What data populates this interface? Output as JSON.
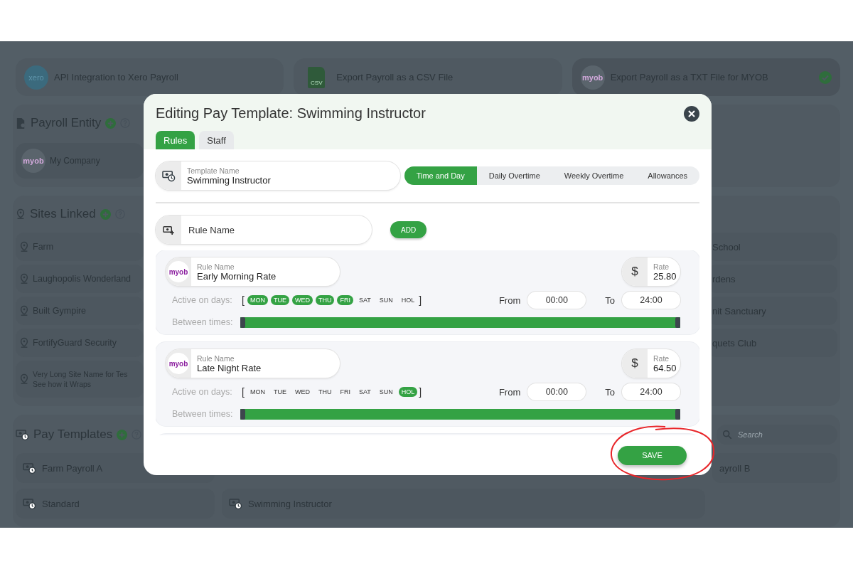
{
  "background": {
    "payroll_formats": [
      {
        "kind": "xero",
        "logo": "xero",
        "label": "API Integration to Xero Payroll",
        "selected": false
      },
      {
        "kind": "csv",
        "logo": "CSV",
        "label": "Export Payroll as a CSV File",
        "selected": false
      },
      {
        "kind": "myob",
        "logo": "myob",
        "label": "Export Payroll as a TXT File for MYOB",
        "selected": true
      }
    ],
    "payroll_entity": {
      "title": "Payroll Entity",
      "items": [
        {
          "logo": "myob",
          "label": "My Company"
        }
      ]
    },
    "sites_linked": {
      "title": "Sites Linked",
      "left": [
        "Farm",
        "Laughopolis Wonderland",
        "Built Gympire",
        "FortifyGuard Security",
        "Very Long Site Name for Tes\nSee how it Wraps"
      ],
      "right": [
        "School",
        "rdens",
        "nit Sanctuary",
        "quets Club"
      ]
    },
    "pay_templates": {
      "title": "Pay Templates",
      "search": {
        "placeholder": "Search"
      },
      "left": [
        "Farm Payroll A",
        "Standard"
      ],
      "middle": [
        "Swimming Instructor"
      ],
      "right": [
        "ayroll B"
      ]
    }
  },
  "modal": {
    "title": "Editing Pay Template: Swimming Instructor",
    "tabs": [
      {
        "label": "Rules",
        "selected": true
      },
      {
        "label": "Staff",
        "selected": false
      }
    ],
    "template_name": {
      "label": "Template Name",
      "value": "Swimming Instructor"
    },
    "rule_tabs": [
      {
        "label": "Time and Day",
        "selected": true
      },
      {
        "label": "Daily Overtime",
        "selected": false
      },
      {
        "label": "Weekly Overtime",
        "selected": false
      },
      {
        "label": "Allowances",
        "selected": false
      }
    ],
    "new_rule": {
      "placeholder": "Rule Name",
      "button": "ADD"
    },
    "rules": [
      {
        "name_label": "Rule Name",
        "logo": "myob",
        "name": "Early Morning Rate",
        "rate_label": "Rate",
        "currency": "$",
        "rate": "25.80",
        "days_label": "Active on days:",
        "open_bracket": "[",
        "close_bracket": "]",
        "days": [
          {
            "label": "MON",
            "on": true
          },
          {
            "label": "TUE",
            "on": true
          },
          {
            "label": "WED",
            "on": true
          },
          {
            "label": "THU",
            "on": true
          },
          {
            "label": "FRI",
            "on": true
          },
          {
            "label": "SAT",
            "on": false
          },
          {
            "label": "SUN",
            "on": false
          },
          {
            "label": "HOL",
            "on": false
          }
        ],
        "from_label": "From",
        "from": "00:00",
        "to_label": "To",
        "to": "24:00",
        "times_label": "Between times:",
        "level": 1
      },
      {
        "name_label": "Rule Name",
        "logo": "myob",
        "name": "Late Night Rate",
        "rate_label": "Rate",
        "currency": "$",
        "rate": "64.50",
        "days_label": "Active on days:",
        "open_bracket": "[",
        "close_bracket": "]",
        "days": [
          {
            "label": "MON",
            "on": false
          },
          {
            "label": "TUE",
            "on": false
          },
          {
            "label": "WED",
            "on": false
          },
          {
            "label": "THU",
            "on": false
          },
          {
            "label": "FRI",
            "on": false
          },
          {
            "label": "SAT",
            "on": false
          },
          {
            "label": "SUN",
            "on": false
          },
          {
            "label": "HOL",
            "on": true
          }
        ],
        "from_label": "From",
        "from": "00:00",
        "to_label": "To",
        "to": "24:00",
        "times_label": "Between times:",
        "level": 1
      }
    ],
    "save": "SAVE"
  }
}
